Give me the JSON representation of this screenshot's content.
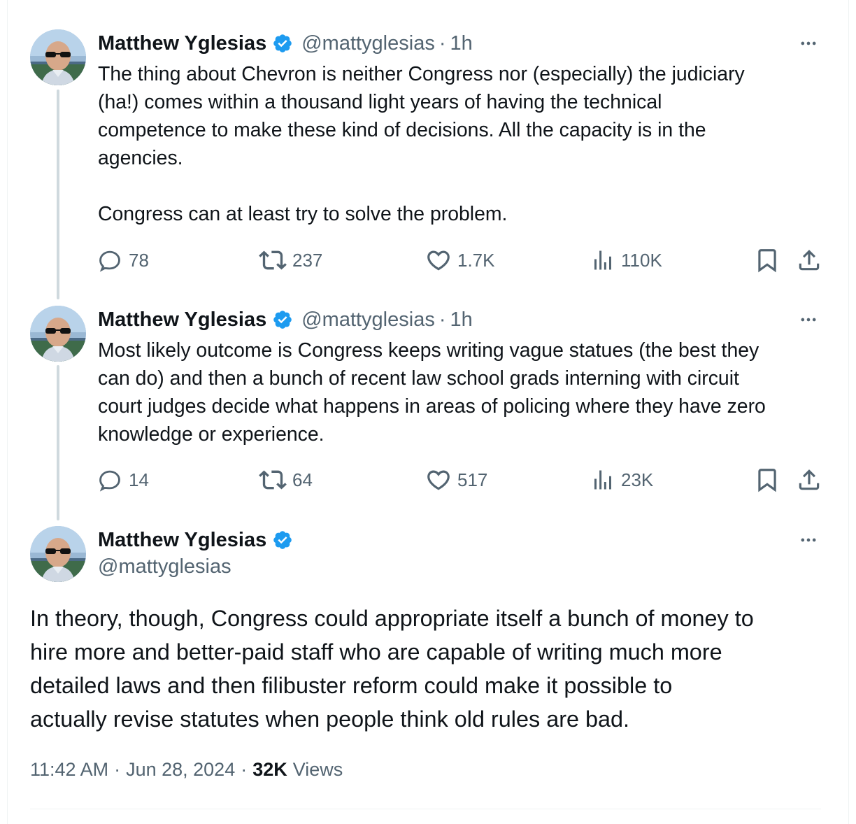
{
  "colors": {
    "text": "#0f1419",
    "secondary": "#536471",
    "verified_blue": "#1d9bf0",
    "thread_line": "#cfd9de",
    "divider": "#eff3f4"
  },
  "icons": {
    "verified": "verified-badge-icon",
    "more": "more-horizontal-icon",
    "reply": "reply-icon",
    "retweet": "retweet-icon",
    "like": "heart-icon",
    "views": "views-chart-icon",
    "bookmark": "bookmark-icon",
    "share": "share-icon"
  },
  "thread": [
    {
      "author": {
        "name": "Matthew Yglesias",
        "handle": "@mattyglesias"
      },
      "separator": "·",
      "time": "1h",
      "text": "The thing about Chevron is neither Congress nor (especially) the judiciary\n(ha!) comes within a thousand light years of having the technical\ncompetence to make these kind of decisions. All the capacity is in the\nagencies.\n\nCongress can at least try to solve the problem.",
      "stats": {
        "replies": "78",
        "reposts": "237",
        "likes": "1.7K",
        "views": "110K"
      }
    },
    {
      "author": {
        "name": "Matthew Yglesias",
        "handle": "@mattyglesias"
      },
      "separator": "·",
      "time": "1h",
      "text": "Most likely outcome is Congress keeps writing vague statues (the best they\ncan do) and then a bunch of recent law school grads interning with circuit\ncourt judges decide what happens in areas of policing where they have zero\nknowledge or experience.",
      "stats": {
        "replies": "14",
        "reposts": "64",
        "likes": "517",
        "views": "23K"
      }
    }
  ],
  "main_tweet": {
    "author": {
      "name": "Matthew Yglesias",
      "handle": "@mattyglesias"
    },
    "text": "In theory, though, Congress could appropriate itself a bunch of money to\nhire more and better-paid staff who are capable of writing much more\ndetailed laws and then filibuster reform could make it possible to\nactually revise statutes when people think old rules are bad.",
    "time": "11:42 AM",
    "date": "Jun 28, 2024",
    "separator": "·",
    "views_count": "32K",
    "views_label": "Views"
  }
}
